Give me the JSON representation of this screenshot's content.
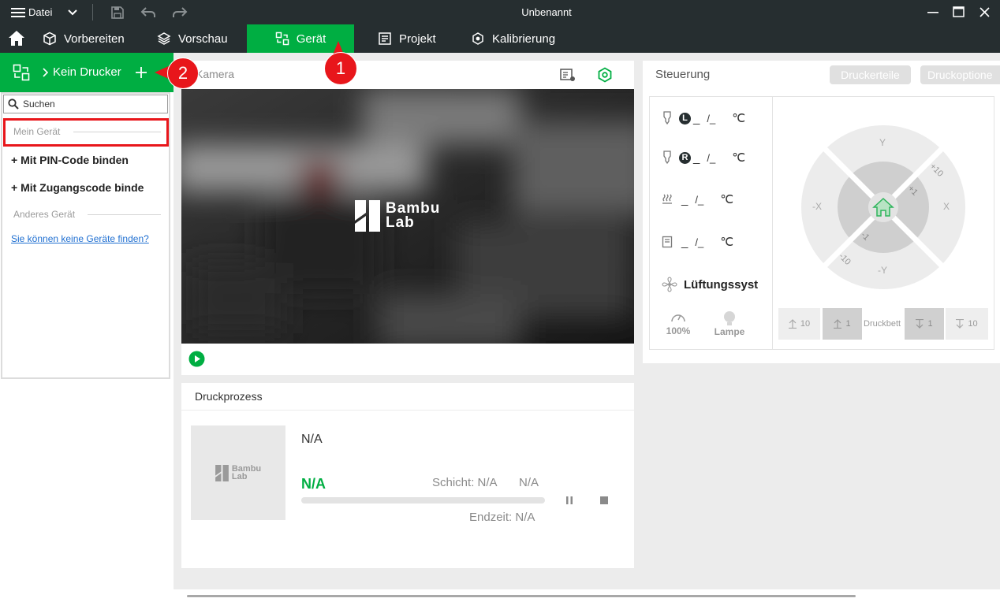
{
  "titlebar": {
    "file_menu": "Datei",
    "title": "Unbenannt"
  },
  "nav": {
    "tabs": [
      "Vorbereiten",
      "Vorschau",
      "Gerät",
      "Projekt",
      "Kalibrierung"
    ],
    "active_tab": "Gerät"
  },
  "sidebar": {
    "no_printer": "Kein Drucker",
    "search_placeholder": "Suchen",
    "my_device": "Mein Gerät",
    "bind_pin": "Mit PIN-Code binden",
    "bind_access": "Mit Zugangscode binde",
    "other_device": "Anderes Gerät",
    "cant_find": "Sie können keine Geräte finden?"
  },
  "annotations": {
    "badge1": "1",
    "badge2": "2"
  },
  "camera": {
    "title": "Kamera",
    "logo_line1": "Bambu",
    "logo_line2": "Lab"
  },
  "print_progress": {
    "title": "Druckprozess",
    "name": "N/A",
    "percent": "N/A",
    "layer": "Schicht: N/A",
    "time_left": "N/A",
    "end_time": "Endzeit: N/A",
    "progress": 0
  },
  "control": {
    "title": "Steuerung",
    "printer_parts_button": "Druckerteile",
    "print_options_button": "Druckoptione",
    "temps": [
      {
        "badge": "L",
        "value": "_",
        "target": "/_",
        "unit": "℃"
      },
      {
        "badge": "R",
        "value": "_",
        "target": "/_",
        "unit": "℃"
      },
      {
        "value": "_",
        "target": "/_",
        "unit": "℃"
      },
      {
        "value": "_",
        "target": "/_",
        "unit": "℃"
      }
    ],
    "fan_label": "Lüftungssyst",
    "speed": "100%",
    "lamp": "Lampe",
    "jog": {
      "y_plus": "Y",
      "y_minus": "-Y",
      "x_plus": "X",
      "x_minus": "-X",
      "p10": "+10",
      "p1": "+1",
      "m1": "-1",
      "m10": "-10"
    },
    "bed": {
      "label": "Druckbett",
      "up10": "10",
      "up1": "1",
      "down1": "1",
      "down10": "10"
    }
  },
  "colors": {
    "accent": "#00ae42",
    "dark": "#262e30",
    "annotation_red": "#e8161b"
  }
}
